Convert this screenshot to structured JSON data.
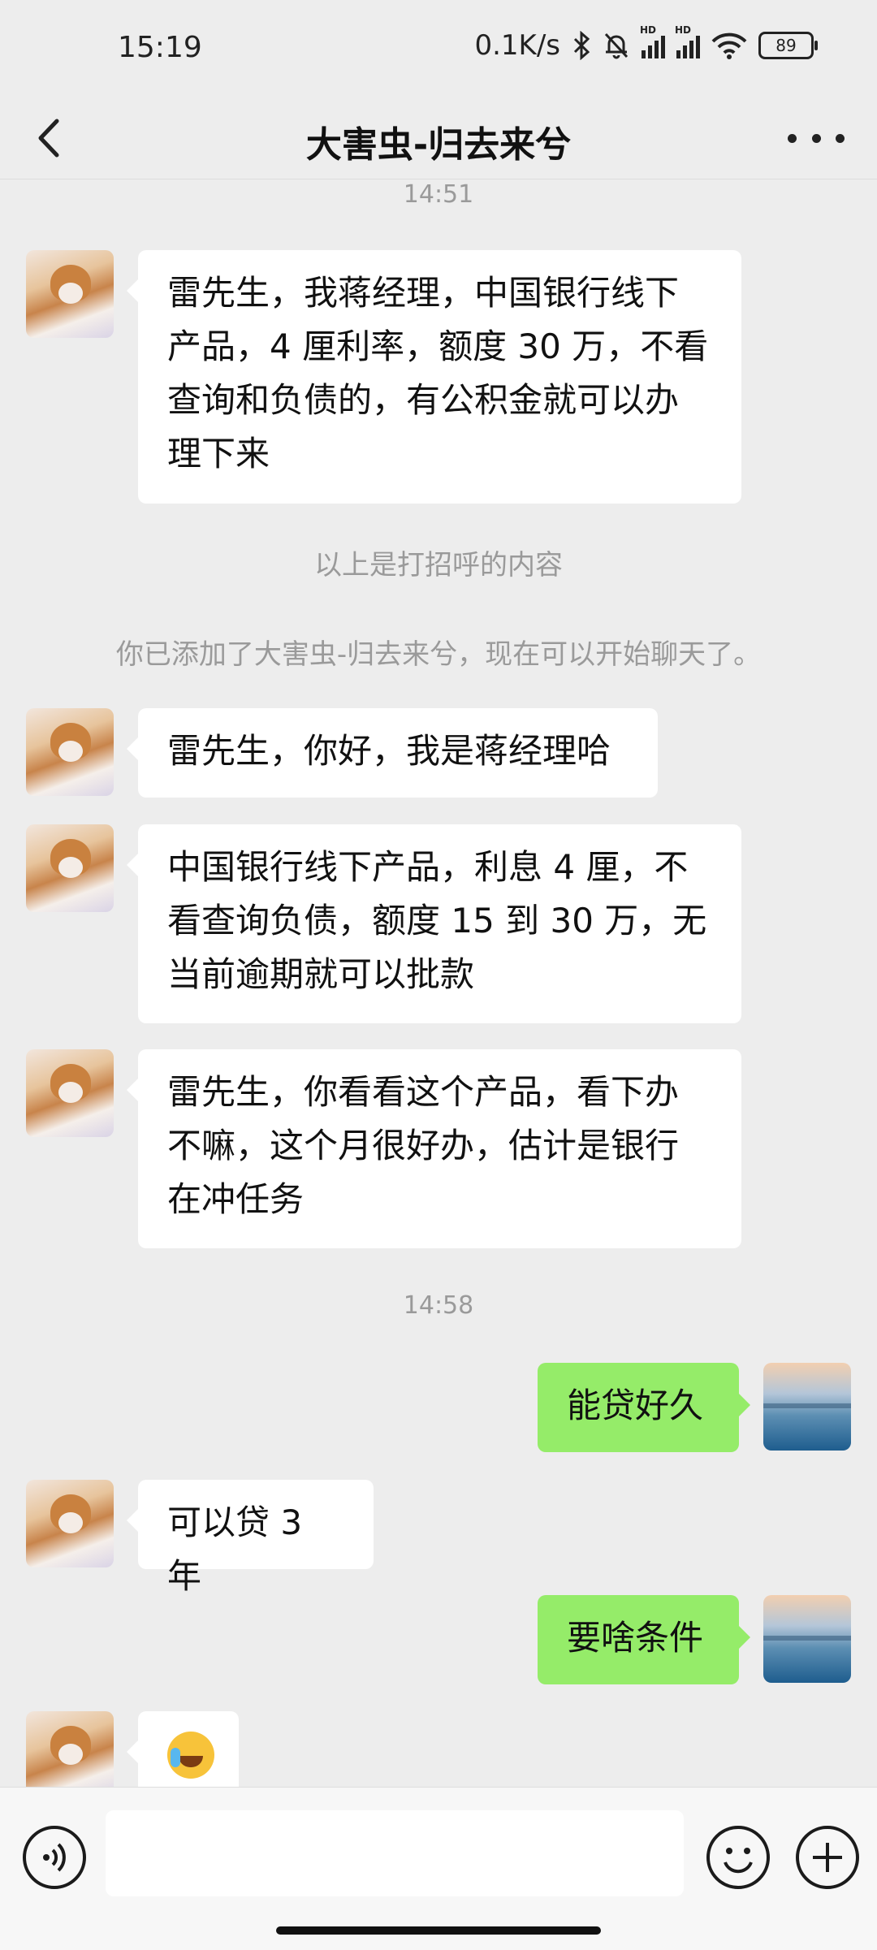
{
  "status_bar": {
    "time": "15:19",
    "net_speed": "0.1K/s",
    "signal1_label": "HD",
    "signal2_label": "HD",
    "battery": "89"
  },
  "nav": {
    "title": "大害虫-归去来兮",
    "back_icon": "chevron-left-icon",
    "more_icon": "more-dots-icon"
  },
  "messages": {
    "ts1": "14:51",
    "m1": [
      "雷先生，我蒋经理，中国银行线下",
      "产品，4 厘利率，额度 30 万，不看",
      "查询和负债的，有公积金就可以办",
      "理下来"
    ],
    "sys1": "以上是打招呼的内容",
    "sys2": "你已添加了大害虫-归去来兮，现在可以开始聊天了。",
    "m2": "雷先生，你好，我是蒋经理哈",
    "m3": [
      "中国银行线下产品，利息 4 厘，不",
      "看查询负债，额度 15 到 30 万，无",
      "当前逾期就可以批款"
    ],
    "m4": [
      "雷先生，你看看这个产品，看下办",
      "不嘛，这个月很好办，估计是银行",
      "在冲任务"
    ],
    "ts2": "14:58",
    "m5": "能贷好久",
    "m6": "可以贷 3 年",
    "m7": "要啥条件",
    "m8_icon": "crying-laughing-emoji"
  },
  "input": {
    "placeholder": "",
    "voice_icon": "voice-icon",
    "emoji_icon": "smiley-icon",
    "plus_icon": "plus-icon"
  },
  "colors": {
    "background": "#ededed",
    "incoming_bubble": "#ffffff",
    "outgoing_bubble": "#95ec69"
  }
}
